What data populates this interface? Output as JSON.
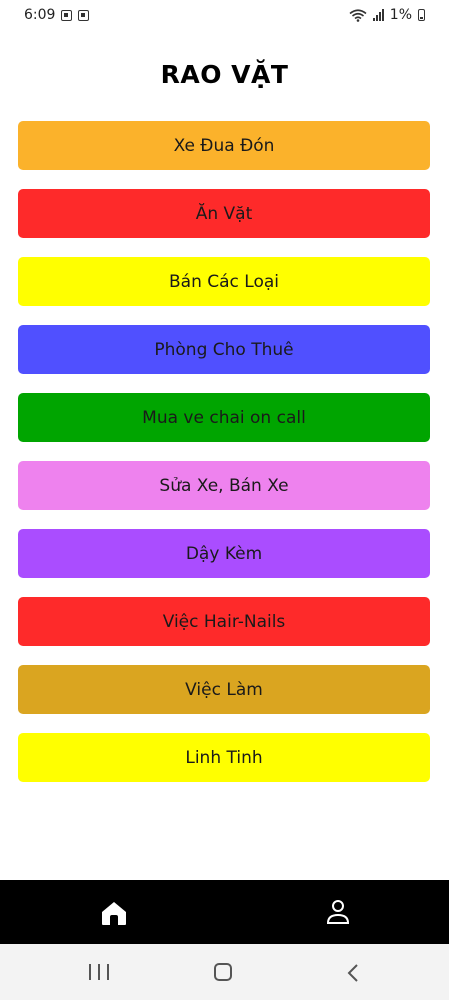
{
  "status_bar": {
    "time": "6:09",
    "battery_text": "1%"
  },
  "header": {
    "title": "RAO VẶT"
  },
  "menu": [
    {
      "label": "Xe Đua Đón",
      "color": "#fbb22b"
    },
    {
      "label": "Ăn Vặt",
      "color": "#fe2a2a"
    },
    {
      "label": "Bán Các Loại",
      "color": "#ffff00"
    },
    {
      "label": "Phòng Cho Thuê",
      "color": "#5050ff"
    },
    {
      "label": "Mua ve chai on call",
      "color": "#00a500"
    },
    {
      "label": "Sửa Xe, Bán Xe",
      "color": "#ee82ee"
    },
    {
      "label": "Dậy Kèm",
      "color": "#aa4dff"
    },
    {
      "label": "Việc Hair-Nails",
      "color": "#fe2a2a"
    },
    {
      "label": "Việc Làm",
      "color": "#daa520"
    },
    {
      "label": "Linh Tinh",
      "color": "#ffff00"
    }
  ],
  "bottom_nav": {
    "items": [
      {
        "icon": "home-icon"
      },
      {
        "icon": "profile-icon"
      }
    ]
  },
  "system_nav": {
    "icons": [
      "recent-apps-icon",
      "home-button-icon",
      "back-icon"
    ]
  }
}
